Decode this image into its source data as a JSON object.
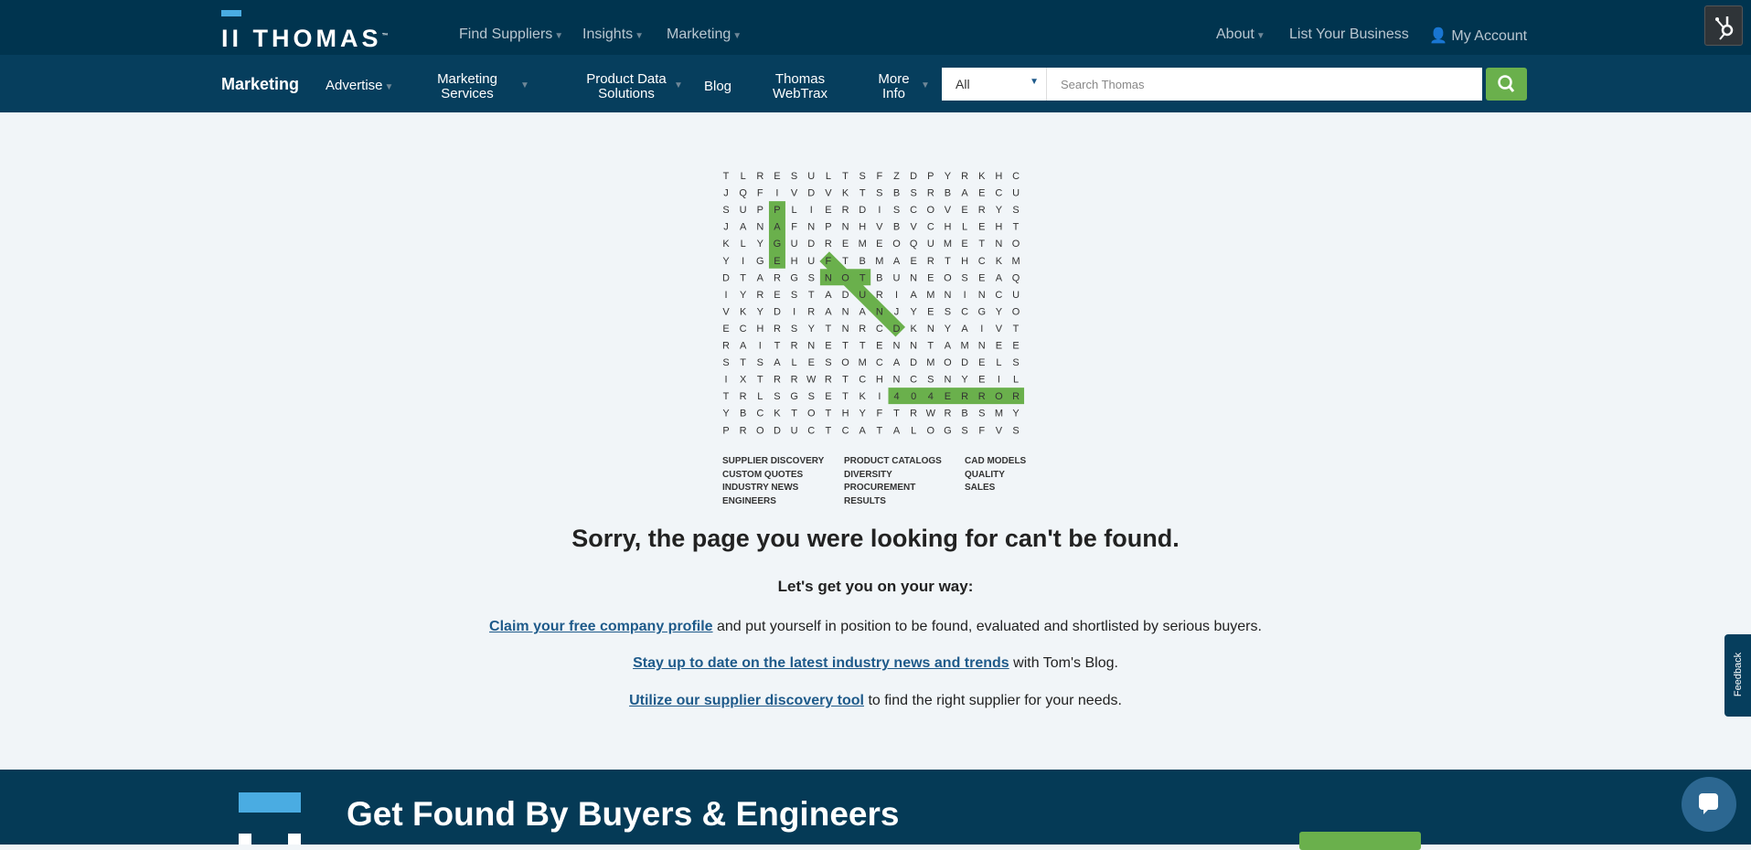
{
  "header": {
    "logo_text": "THOMAS",
    "logo_tm": "™",
    "nav": [
      "Find Suppliers",
      "Insights",
      "Marketing"
    ],
    "right": {
      "about": "About",
      "list_business": "List Your Business",
      "account": "My Account"
    }
  },
  "subnav": {
    "title": "Marketing",
    "items": [
      "Advertise",
      "Marketing Services",
      "Product Data Solutions",
      "Blog",
      "Thomas WebTrax",
      "More Info"
    ],
    "select_value": "All",
    "search_placeholder": "Search Thomas"
  },
  "puzzle": {
    "rows": [
      "TLRESULTSFZDPYRKHC",
      "JQFIVDVKTSBSRBAECU",
      "SUPPLIERDISCOVERYS",
      "JANAFNPNHVBVCHLEHT",
      "KLYGUDREMEOQUMETNO",
      "YIGEHUFTBMAERTHCKM",
      "DTARGSNOTBUNEOSEAQ",
      "IYRESTADURIAMNINCU",
      "VKYDIRANANJYESCGYO",
      "ECHRSYTNRCDKNYAIVT",
      "RAITRNETTENNTAMNEE",
      "STSALESOMCADMODELS",
      "IXTRRWRTCHNCSNYEIL",
      "TRLSGSETKI404ERROR",
      "YBCKTOTHYFTRWRBSMY",
      "PRODUCTCATALOGSFVS"
    ],
    "highlights": [
      {
        "word": "PAGE",
        "from": [
          2,
          3
        ],
        "to": [
          5,
          3
        ]
      },
      {
        "word": "NOT",
        "from": [
          6,
          6
        ],
        "to": [
          6,
          8
        ]
      },
      {
        "word": "FOUND",
        "from": [
          5,
          6
        ],
        "to": [
          9,
          10
        ]
      },
      {
        "word": "404ERROR",
        "from": [
          13,
          10
        ],
        "to": [
          13,
          17
        ]
      }
    ],
    "highlight_color": "#6ab04c",
    "word_list": [
      [
        "SUPPLIER DISCOVERY",
        "CUSTOM QUOTES",
        "INDUSTRY NEWS",
        "ENGINEERS"
      ],
      [
        "PRODUCT CATALOGS",
        "DIVERSITY",
        "PROCUREMENT",
        "RESULTS"
      ],
      [
        "CAD MODELS",
        "QUALITY",
        "SALES"
      ]
    ]
  },
  "main": {
    "heading": "Sorry, the page you were looking for can't be found.",
    "subheading": "Let's get you on your way:",
    "lines": [
      {
        "link": "Claim your free company profile",
        "text": " and put yourself in position to be found, evaluated and shortlisted by serious buyers."
      },
      {
        "link": "Stay up to date on the latest industry news and trends",
        "text": " with Tom's Blog."
      },
      {
        "link": "Utilize our supplier discovery tool",
        "text": " to find the right supplier for your needs."
      }
    ]
  },
  "feedback": "Feedback",
  "footer": {
    "heading": "Get Found By Buyers & Engineers"
  }
}
